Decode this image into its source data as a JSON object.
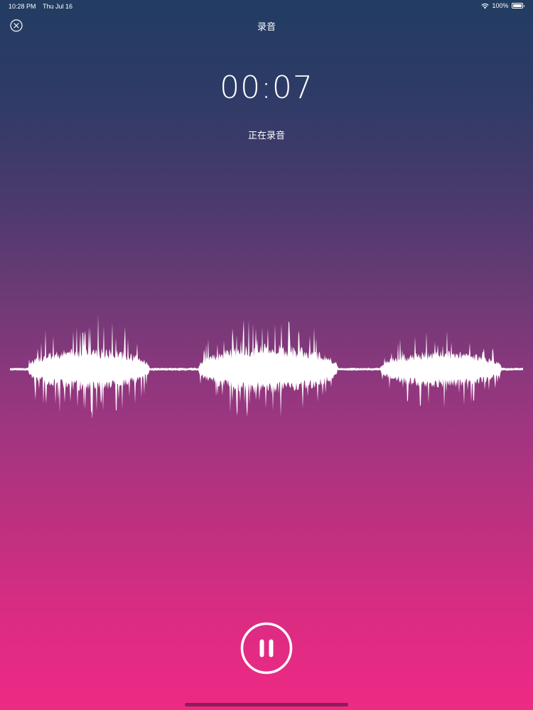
{
  "status_bar": {
    "time": "10:28 PM",
    "date": "Thu Jul 16",
    "battery": "100%",
    "wifi_icon": "wifi-icon",
    "battery_icon": "battery-icon"
  },
  "nav": {
    "title": "录音",
    "close_icon": "close-circle-icon"
  },
  "recording": {
    "elapsed": "00:07",
    "status": "正在录音"
  },
  "controls": {
    "pause_icon": "pause-icon"
  },
  "colors": {
    "gradient_top": "#223c62",
    "gradient_bottom": "#ee2a84",
    "foreground": "#ffffff"
  }
}
